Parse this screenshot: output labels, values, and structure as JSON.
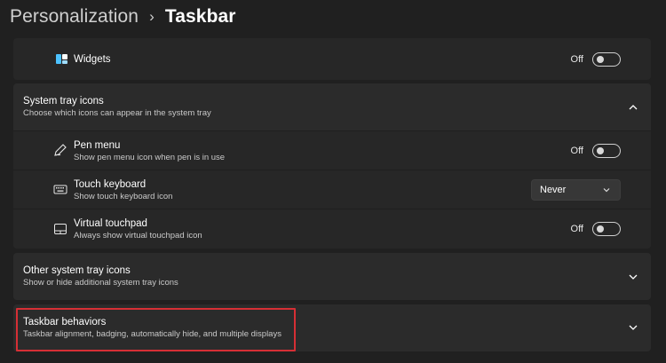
{
  "breadcrumb": {
    "parent": "Personalization",
    "separator": "›",
    "current": "Taskbar"
  },
  "widgets": {
    "title": "Widgets",
    "toggle_state": "Off"
  },
  "system_tray": {
    "title": "System tray icons",
    "description": "Choose which icons can appear in the system tray",
    "items": [
      {
        "title": "Pen menu",
        "description": "Show pen menu icon when pen is in use",
        "control": "toggle",
        "state": "Off"
      },
      {
        "title": "Touch keyboard",
        "description": "Show touch keyboard icon",
        "control": "select",
        "value": "Never"
      },
      {
        "title": "Virtual touchpad",
        "description": "Always show virtual touchpad icon",
        "control": "toggle",
        "state": "Off"
      }
    ]
  },
  "other_tray": {
    "title": "Other system tray icons",
    "description": "Show or hide additional system tray icons"
  },
  "behaviors": {
    "title": "Taskbar behaviors",
    "description": "Taskbar alignment, badging, automatically hide, and multiple displays"
  }
}
